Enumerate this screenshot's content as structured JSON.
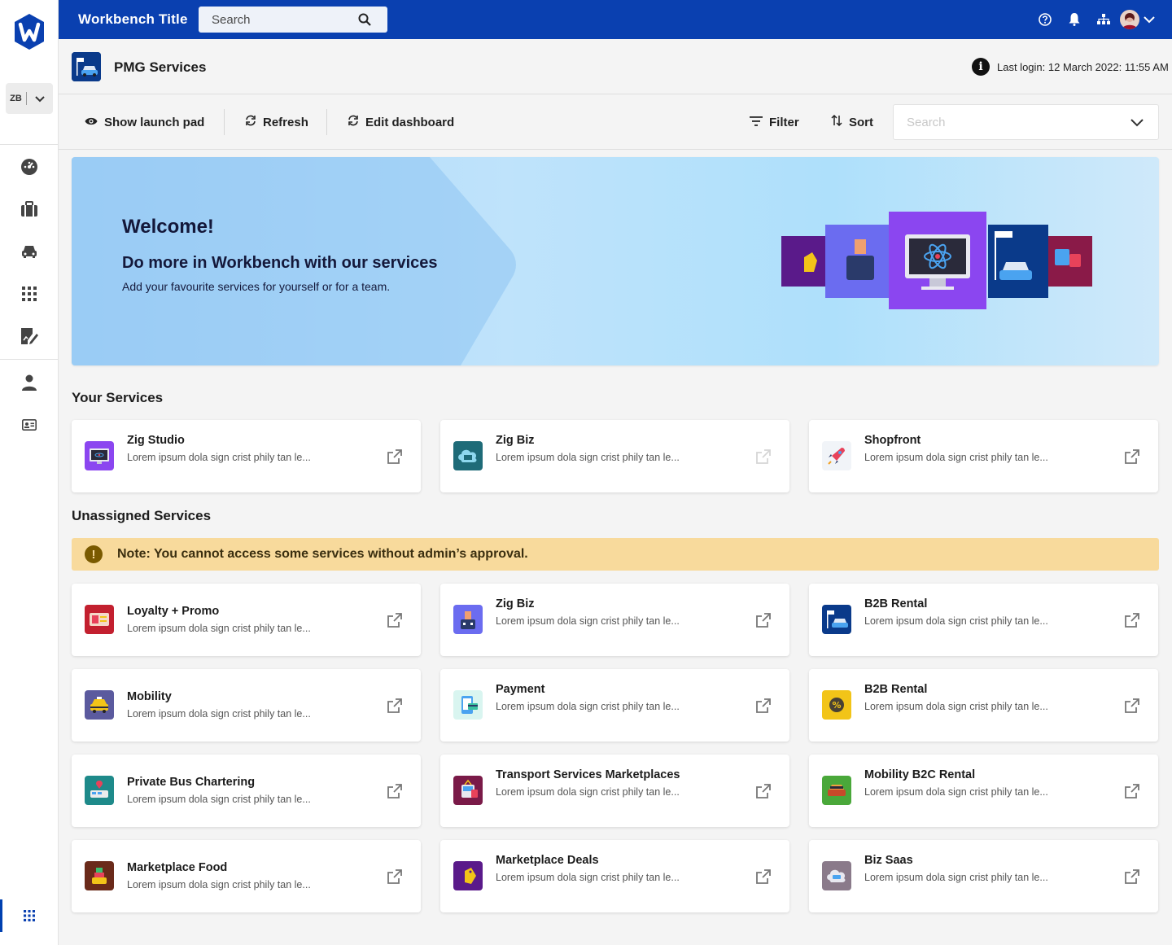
{
  "app": {
    "title": "Workbench Title",
    "search_placeholder": "Search",
    "workspace_abbr": "ZB"
  },
  "sidebar": {
    "items": [
      {
        "icon": "dashboard-icon"
      },
      {
        "icon": "briefcase-icon"
      },
      {
        "icon": "car-icon"
      },
      {
        "icon": "apps-grid-icon"
      },
      {
        "icon": "edit-document-icon"
      },
      {
        "icon": "person-icon"
      },
      {
        "icon": "id-card-icon"
      }
    ],
    "bottom_item": {
      "icon": "apps-grid-icon",
      "active": true
    }
  },
  "page": {
    "title": "PMG Services",
    "last_login": "Last login: 12 March 2022: 11:55 AM"
  },
  "toolbar": {
    "show_launch_pad": "Show launch pad",
    "refresh": "Refresh",
    "edit_dashboard": "Edit dashboard",
    "filter": "Filter",
    "sort": "Sort",
    "search_placeholder": "Search"
  },
  "banner": {
    "heading": "Welcome!",
    "subheading": "Do more in Workbench with our services",
    "text": "Add your favourite services for yourself or for a team."
  },
  "your_services": {
    "heading": "Your Services",
    "items": [
      {
        "title": "Zig Studio",
        "desc": "Lorem ipsum dola sign crist phily tan le...",
        "icon": "monitor-atom-icon",
        "color": "#8b46f0"
      },
      {
        "title": "Zig Biz",
        "desc": "Lorem ipsum dola sign crist phily tan le...",
        "icon": "cloud-icon",
        "color": "#1e6b78",
        "disabled": true
      },
      {
        "title": "Shopfront",
        "desc": "Lorem ipsum dola sign crist phily tan le...",
        "icon": "rocket-icon",
        "color": "#f1f4f8"
      }
    ]
  },
  "unassigned": {
    "heading": "Unassigned Services",
    "note": "Note: You cannot access some services without admin’s approval.",
    "items": [
      {
        "title": "Loyalty + Promo",
        "desc": "Lorem ipsum dola sign crist phily tan le...",
        "icon": "ticket-icon",
        "color": "#c3202f"
      },
      {
        "title": "Zig Biz",
        "desc": "Lorem ipsum dola sign crist phily tan le...",
        "icon": "briefcase-person-icon",
        "color": "#6b6cf0"
      },
      {
        "title": "B2B Rental",
        "desc": "Lorem ipsum dola sign crist phily tan le...",
        "icon": "rent-car-icon",
        "color": "#0a3a8a"
      },
      {
        "title": "Mobility",
        "desc": "Lorem ipsum dola sign crist phily tan le...",
        "icon": "taxi-icon",
        "color": "#5b5a9e"
      },
      {
        "title": "Payment",
        "desc": "Lorem ipsum dola sign crist phily tan le...",
        "icon": "payment-icon",
        "color": "#d9f5f0"
      },
      {
        "title": "B2B Rental",
        "desc": "Lorem ipsum dola sign crist phily tan le...",
        "icon": "discount-badge-icon",
        "color": "#f2c418"
      },
      {
        "title": "Private Bus Chartering",
        "desc": "Lorem ipsum dola sign crist phily tan le...",
        "icon": "bus-location-icon",
        "color": "#1e8a8a"
      },
      {
        "title": "Transport Services Marketplaces",
        "desc": "Lorem ipsum dola sign crist phily tan le...",
        "icon": "tram-icon",
        "color": "#7a1a48"
      },
      {
        "title": "Mobility B2C Rental",
        "desc": "Lorem ipsum dola sign crist phily tan le...",
        "icon": "car-rental-icon",
        "color": "#4aa83a"
      },
      {
        "title": "Marketplace Food",
        "desc": "Lorem ipsum dola sign crist phily tan le...",
        "icon": "food-icon",
        "color": "#6a2a1a"
      },
      {
        "title": "Marketplace Deals",
        "desc": "Lorem ipsum dola sign crist phily tan le...",
        "icon": "price-tag-icon",
        "color": "#5a1a8a"
      },
      {
        "title": "Biz Saas",
        "desc": "Lorem ipsum dola sign crist phily tan le...",
        "icon": "saas-cloud-icon",
        "color": "#8a7a8a"
      }
    ]
  }
}
